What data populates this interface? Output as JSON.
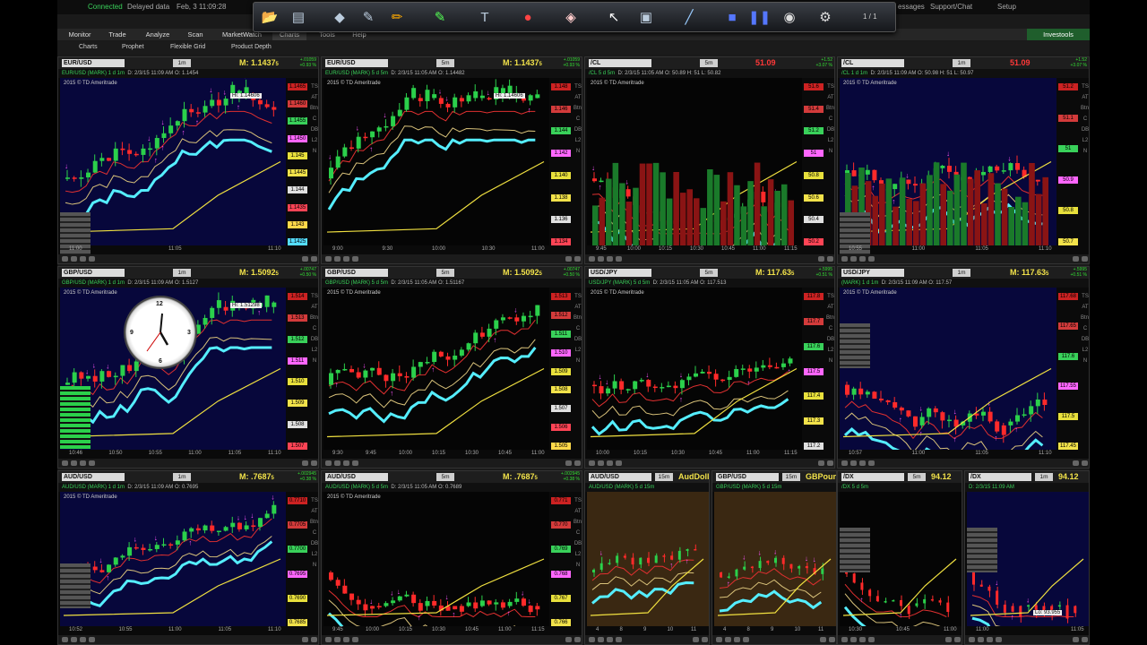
{
  "status": {
    "connected": "Connected",
    "delayed": "Delayed data",
    "datetime": "Feb, 3 11:09:28",
    "messages": "essages",
    "support": "Support/Chat",
    "setup": "Setup"
  },
  "toolbar": {
    "page": "1 / 1"
  },
  "tabs": [
    "Monitor",
    "Trade",
    "Analyze",
    "Scan",
    "MarketWatch",
    "Charts",
    "Tools",
    "Help"
  ],
  "subtabs": [
    "Charts",
    "Prophet",
    "Flexible Grid",
    "Product Depth"
  ],
  "brand": "Investools",
  "clock_labels": [
    "12",
    "3",
    "6",
    "9"
  ],
  "panels": [
    {
      "sym": "EUR/USD",
      "tf": "1m",
      "mark": "M: 1.1437",
      "dec": "5",
      "pos": "+.01059",
      "pct": "+0.93 %",
      "desc": "EUR/USD (MARK) 1 d 1m",
      "info": "D: 2/3/15 11:09 AM  O: 1.1454",
      "wm": "2015 © TD Ameritrade",
      "hi": "Hi: 1.14606",
      "ticks": [
        "1.1465",
        "1.1460",
        "1.1455",
        "1.1450",
        "1.145",
        "1.1445",
        "1.144",
        "1.1435",
        "1.143",
        "1.1425"
      ],
      "x": [
        "11:00",
        "11:05",
        "11:10"
      ]
    },
    {
      "sym": "EUR/USD",
      "tf": "5m",
      "mark": "M: 1.1437",
      "dec": "5",
      "pos": "+.01059",
      "pct": "+0.93 %",
      "desc": "EUR/USD (MARK) 5 d 5m",
      "info": "D: 2/3/15 11:05 AM  O: 1.14482",
      "wm": "2015 © TD Ameritrade",
      "hi": "Hi: 1.14606",
      "ticks": [
        "1.148",
        "1.146",
        "1.144",
        "1.142",
        "1.140",
        "1.138",
        "1.136",
        "1.134"
      ],
      "x": [
        "9:00",
        "9:30",
        "10:00",
        "10:30",
        "11:00"
      ]
    },
    {
      "sym": "/CL",
      "tf": "5m",
      "mark": "51.09",
      "dec": "",
      "pos": "+1.52",
      "pct": "+3.07 %",
      "desc": "/CL 5 d 5m",
      "info": "D: 2/3/15 11:05 AM  O: 50.89  H: 51  L: 50.82",
      "wm": "2015 © TD Ameritrade",
      "hi": "",
      "ticks": [
        "51.6",
        "51.4",
        "51.2",
        "51",
        "50.8",
        "50.6",
        "50.4",
        "50.2"
      ],
      "x": [
        "9:45",
        "10:00",
        "10:15",
        "10:30",
        "10:45",
        "11:00",
        "11:15"
      ]
    },
    {
      "sym": "/CL",
      "tf": "1m",
      "mark": "51.09",
      "dec": "",
      "pos": "+1.52",
      "pct": "+3.07 %",
      "desc": "/CL 1 d 1m",
      "info": "D: 2/3/15 11:09 AM  O: 50.98  H: 51  L: 50.97",
      "wm": "2015 © TD Ameritrade",
      "hi": "",
      "ticks": [
        "51.2",
        "51.1",
        "51",
        "50.9",
        "50.8",
        "50.7"
      ],
      "x": [
        "10:55",
        "11:00",
        "11:05",
        "11:10"
      ]
    },
    {
      "sym": "GBP/USD",
      "tf": "1m",
      "mark": "M: 1.5092",
      "dec": "5",
      "pos": "+.00747",
      "pct": "+0.50 %",
      "desc": "GBP/USD (MARK) 1 d 1m",
      "info": "D: 2/3/15 11:09 AM  O: 1.5127",
      "wm": "2015 © TD Ameritrade",
      "hi": "Hi: 1.51298",
      "ticks": [
        "1.514",
        "1.513",
        "1.512",
        "1.511",
        "1.510",
        "1.509",
        "1.508",
        "1.507"
      ],
      "x": [
        "10:46",
        "10:50",
        "10:55",
        "11:00",
        "11:05",
        "11:10"
      ]
    },
    {
      "sym": "GBP/USD",
      "tf": "5m",
      "mark": "M: 1.5092",
      "dec": "5",
      "pos": "+.00747",
      "pct": "+0.50 %",
      "desc": "GBP/USD (MARK) 5 d 5m",
      "info": "D: 2/3/15 11:05 AM  O: 1.51167",
      "wm": "2015 © TD Ameritrade",
      "hi": "",
      "ticks": [
        "1.513",
        "1.512",
        "1.511",
        "1.510",
        "1.509",
        "1.508",
        "1.507",
        "1.506",
        "1.505"
      ],
      "x": [
        "9:30",
        "9:45",
        "10:00",
        "10:15",
        "10:30",
        "10:45",
        "11:00"
      ]
    },
    {
      "sym": "USD/JPY",
      "tf": "5m",
      "mark": "M: 117.63",
      "dec": "5",
      "pos": "+.5995",
      "pct": "+0.51 %",
      "desc": "USD/JPY (MARK) 5 d 5m",
      "info": "D: 2/3/15 11:05 AM  O: 117.513",
      "wm": "2015 © TD Ameritrade",
      "hi": "",
      "ticks": [
        "117.8",
        "117.7",
        "117.6",
        "117.5",
        "117.4",
        "117.3",
        "117.2"
      ],
      "x": [
        "10:00",
        "10:15",
        "10:30",
        "10:45",
        "11:00",
        "11:15"
      ]
    },
    {
      "sym": "USD/JPY",
      "tf": "1m",
      "mark": "M: 117.63",
      "dec": "5",
      "pos": "+.5995",
      "pct": "+0.51 %",
      "desc": "(MARK) 1 d 1m",
      "info": "D: 2/3/15 11:09 AM  O: 117.57",
      "wm": "2015 © TD Ameritrade",
      "hi": "",
      "ticks": [
        "117.68",
        "117.65",
        "117.6",
        "117.55",
        "117.5",
        "117.45"
      ],
      "x": [
        "10:57",
        "11:00",
        "11:05",
        "11:10"
      ]
    },
    {
      "sym": "AUD/USD",
      "tf": "1m",
      "mark": "M: .7687",
      "dec": "5",
      "pos": "+.002945",
      "pct": "+0.38 %",
      "desc": "AUD/USD (MARK) 1 d 1m",
      "info": "D: 2/3/15 11:09 AM  O: 0.7695",
      "wm": "2015 © TD Ameritrade",
      "hi": "",
      "ticks": [
        "0.7710",
        "0.7705",
        "0.7700",
        "0.7695",
        "0.7690",
        "0.7685"
      ],
      "x": [
        "10:52",
        "10:55",
        "11:00",
        "11:05",
        "11:10"
      ]
    },
    {
      "sym": "AUD/USD",
      "tf": "5m",
      "mark": "M: .7687",
      "dec": "5",
      "pos": "+.002945",
      "pct": "+0.38 %",
      "desc": "AUD/USD (MARK) 5 d 5m",
      "info": "D: 2/3/15 11:05 AM  O: 0.7689",
      "wm": "2015 © TD Ameritrade",
      "hi": "",
      "ticks": [
        "0.771",
        "0.770",
        "0.769",
        "0.768",
        "0.767",
        "0.766"
      ],
      "x": [
        "9:45",
        "10:00",
        "10:15",
        "10:30",
        "10:45",
        "11:00",
        "11:15"
      ]
    },
    {
      "sym": "AUD/USD",
      "tf": "15m",
      "mark": "AudDolla",
      "dec": "",
      "pos": "",
      "pct": "",
      "desc": "AUD/USD (MARK) 5 d 15m",
      "info": "",
      "wm": "",
      "hi": "",
      "ticks": [],
      "x": [
        "4",
        "8",
        "9",
        "10",
        "11"
      ]
    },
    {
      "sym": "GBP/USD",
      "tf": "15m",
      "mark": "GBPounc",
      "dec": "",
      "pos": "",
      "pct": "",
      "desc": "GBP/USD (MARK) 5 d 15m",
      "info": "",
      "wm": "",
      "hi": "",
      "ticks": [],
      "x": [
        "4",
        "8",
        "9",
        "10",
        "11"
      ]
    },
    {
      "sym": "/DX",
      "tf": "5m",
      "mark": "94.12",
      "dec": "",
      "pos": "",
      "pct": "",
      "desc": "/DX 5 d 5m",
      "info": "",
      "wm": "",
      "hi": "",
      "ticks": [],
      "x": [
        "10:30",
        "10:45",
        "11:00"
      ]
    },
    {
      "sym": "/DX",
      "tf": "1m",
      "mark": "94.12",
      "dec": "",
      "pos": "",
      "pct": "",
      "desc": "D: 2/3/15 11:09 AM",
      "info": "",
      "wm": "",
      "hi": "Lo: 93.955",
      "ticks": [],
      "x": [
        "11:00",
        "11:05"
      ]
    }
  ]
}
